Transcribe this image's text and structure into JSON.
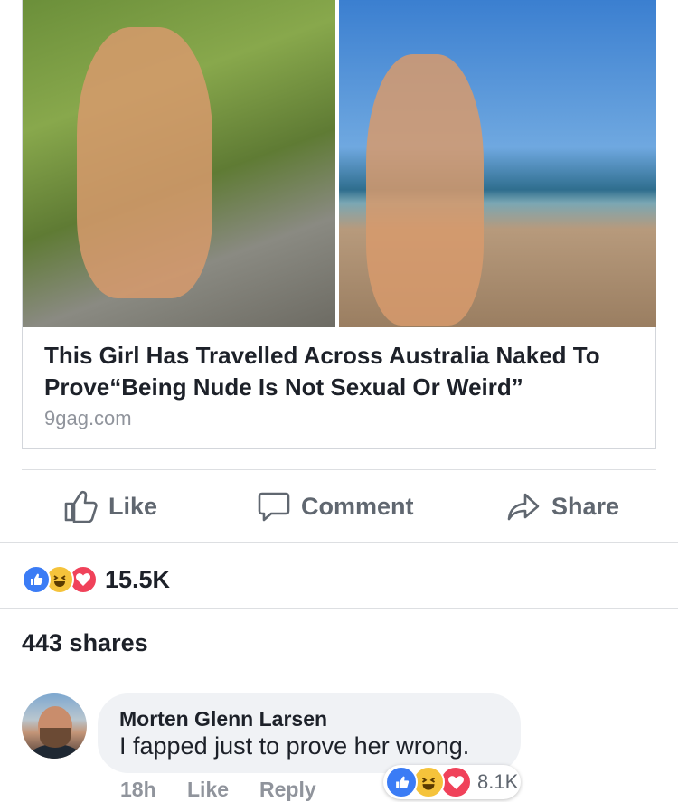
{
  "link_card": {
    "title": "This Girl Has Travelled Across Australia Naked To Prove“Being Nude Is Not Sexual Or Weird”",
    "domain": "9gag.com"
  },
  "actions": {
    "like_label": "Like",
    "comment_label": "Comment",
    "share_label": "Share"
  },
  "reactions": {
    "types": [
      "like-icon",
      "haha-icon",
      "love-icon"
    ],
    "count": "15.5K"
  },
  "shares": "443 shares",
  "comment": {
    "author": "Morten Glenn Larsen",
    "text": "I fapped just to prove her wrong.",
    "time": "18h",
    "like_label": "Like",
    "reply_label": "Reply",
    "reaction_count": "8.1K"
  },
  "colors": {
    "like_blue": "#3b7cf5",
    "haha_yellow": "#f5c33b",
    "love_red": "#f0425a",
    "muted_text": "#606770"
  }
}
